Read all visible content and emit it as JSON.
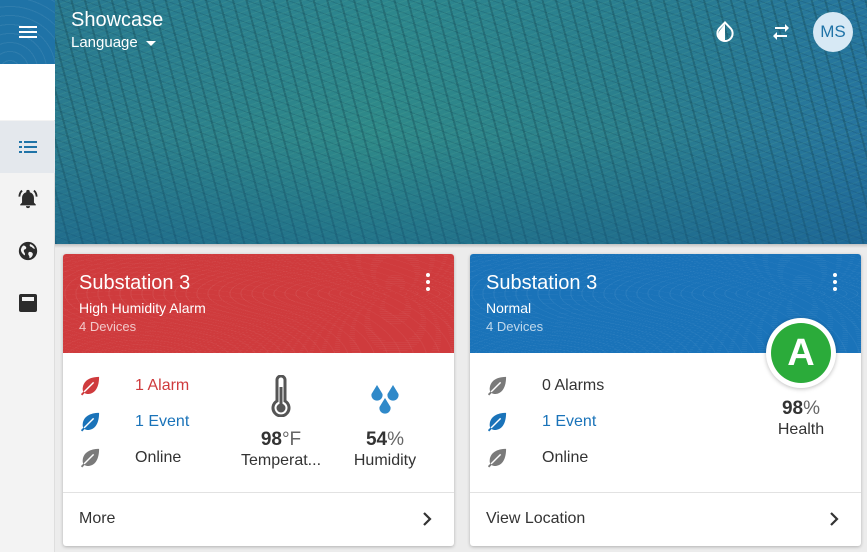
{
  "app": {
    "title": "Showcase",
    "language_label": "Language",
    "user_initials": "MS"
  },
  "icons": {
    "menu": "hamburger-menu-icon",
    "list": "list-icon",
    "alarm": "alarm-bell-icon",
    "globe": "globe-icon",
    "device": "device-icon",
    "theme": "contrast-drop-icon",
    "swap": "swap-arrows-icon",
    "more": "more-vertical-icon",
    "chevron": "chevron-right-icon",
    "leaf": "leaf-icon",
    "thermometer": "thermometer-icon",
    "humidity": "water-drops-icon"
  },
  "colors": {
    "accent": "#1f73a7",
    "alarm": "#cf3b3d",
    "event": "#1a73b9",
    "online": "#7a7a7a",
    "grade": "#2bab3a"
  },
  "cards": [
    {
      "title": "Substation 3",
      "status": "High Humidity Alarm",
      "devices": "4 Devices",
      "alarms": "1 Alarm",
      "events": "1 Event",
      "online": "Online",
      "temperature": {
        "value": "98",
        "unit": "°F",
        "label": "Temperat..."
      },
      "humidity": {
        "value": "54",
        "unit": "%",
        "label": "Humidity"
      },
      "footer_label": "More"
    },
    {
      "title": "Substation 3",
      "status": "Normal",
      "devices": "4 Devices",
      "alarms": "0 Alarms",
      "events": "1 Event",
      "online": "Online",
      "grade": "A",
      "health": {
        "value": "98",
        "unit": "%",
        "label": "Health"
      },
      "footer_label": "View Location"
    }
  ]
}
